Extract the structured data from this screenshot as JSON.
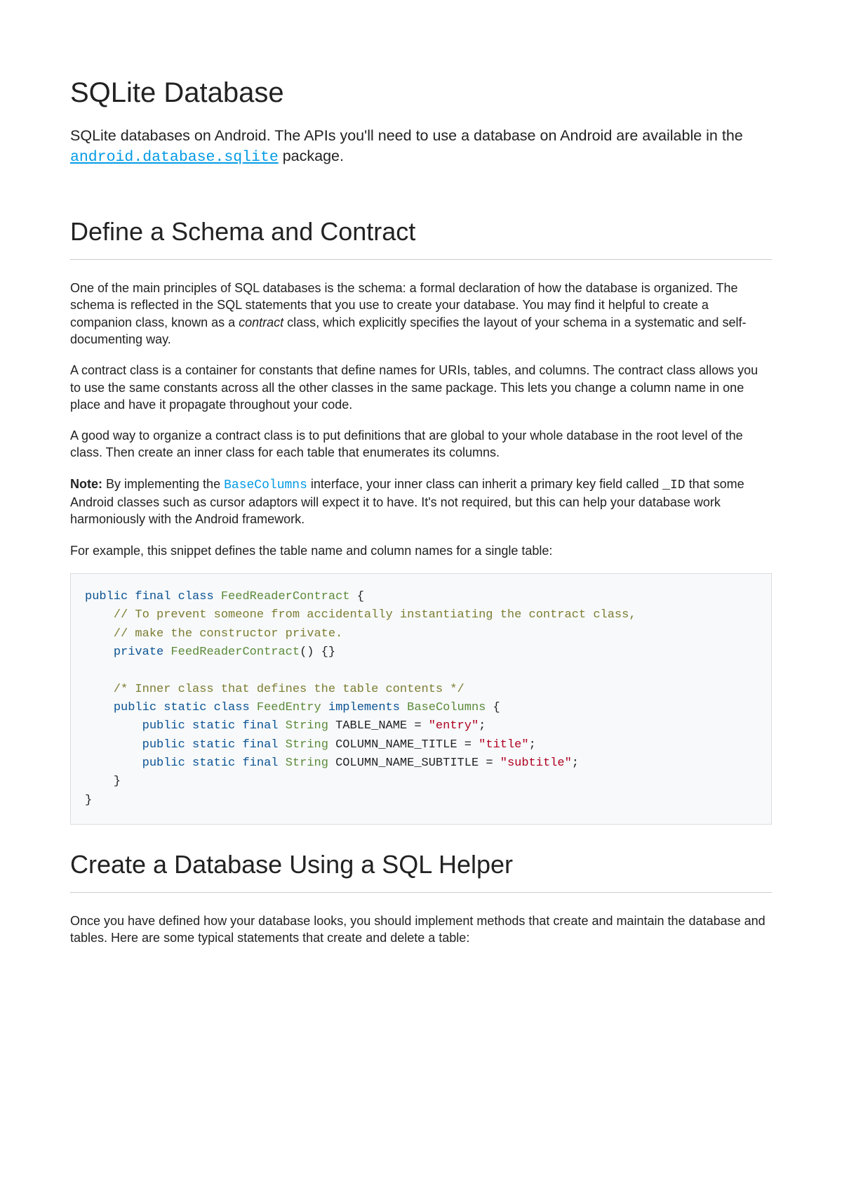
{
  "title": "SQLite Database",
  "intro": {
    "pre": "SQLite databases on Android. The APIs you'll need to use a database on Android are available in the ",
    "link": "android.database.sqlite",
    "post": " package."
  },
  "section1": {
    "heading": "Define a Schema and Contract",
    "p1_a": "One of the main principles of SQL databases is the schema: a formal declaration of how the database is organized. The schema is reflected in the SQL statements that you use to create your database. You may find it helpful to create a companion class, known as a ",
    "p1_em": "contract",
    "p1_b": " class, which explicitly specifies the layout of your schema in a systematic and self-documenting way.",
    "p2": "A contract class is a container for constants that define names for URIs, tables, and columns. The contract class allows you to use the same constants across all the other classes in the same package. This lets you change a column name in one place and have it propagate throughout your code.",
    "p3": "A good way to organize a contract class is to put definitions that are global to your whole database in the root level of the class. Then create an inner class for each table that enumerates its columns.",
    "note": {
      "label": "Note:",
      "a": " By implementing the ",
      "link": "BaseColumns",
      "b": " interface, your inner class can inherit a primary key field called ",
      "id": "_ID",
      "c": " that some Android classes such as cursor adaptors will expect it to have. It's not required, but this can help your database work harmoniously with the Android framework."
    },
    "p5": "For example, this snippet defines the table name and column names for a single table:"
  },
  "code1": {
    "l01_kw1": "public",
    "l01_kw2": "final",
    "l01_kw3": "class",
    "l01_cls": "FeedReaderContract",
    "l01_brace": " {",
    "l02": "    // To prevent someone from accidentally instantiating the contract class,",
    "l03": "    // make the constructor private.",
    "l04_indent": "    ",
    "l04_kw": "private",
    "l04_name": " FeedReaderContract",
    "l04_rest": "() {}",
    "l06": "    /* Inner class that defines the table contents */",
    "l07_indent": "    ",
    "l07_kw1": "public",
    "l07_kw2": "static",
    "l07_kw3": "class",
    "l07_cls": "FeedEntry",
    "l07_kw4": "implements",
    "l07_base": "BaseColumns",
    "l07_brace": " {",
    "l08_indent": "        ",
    "l08_kw1": "public",
    "l08_kw2": "static",
    "l08_kw3": "final",
    "l08_type": "String",
    "l08_name": " TABLE_NAME = ",
    "l08_str": "\"entry\"",
    "l08_semi": ";",
    "l09_indent": "        ",
    "l09_kw1": "public",
    "l09_kw2": "static",
    "l09_kw3": "final",
    "l09_type": "String",
    "l09_name": " COLUMN_NAME_TITLE = ",
    "l09_str": "\"title\"",
    "l09_semi": ";",
    "l10_indent": "        ",
    "l10_kw1": "public",
    "l10_kw2": "static",
    "l10_kw3": "final",
    "l10_type": "String",
    "l10_name": " COLUMN_NAME_SUBTITLE = ",
    "l10_str": "\"subtitle\"",
    "l10_semi": ";",
    "l11": "    }",
    "l12": "}"
  },
  "section2": {
    "heading": "Create a Database Using a SQL Helper",
    "p1": "Once you have defined how your database looks, you should implement methods that create and maintain the database and tables. Here are some typical statements that create and delete a table:"
  }
}
